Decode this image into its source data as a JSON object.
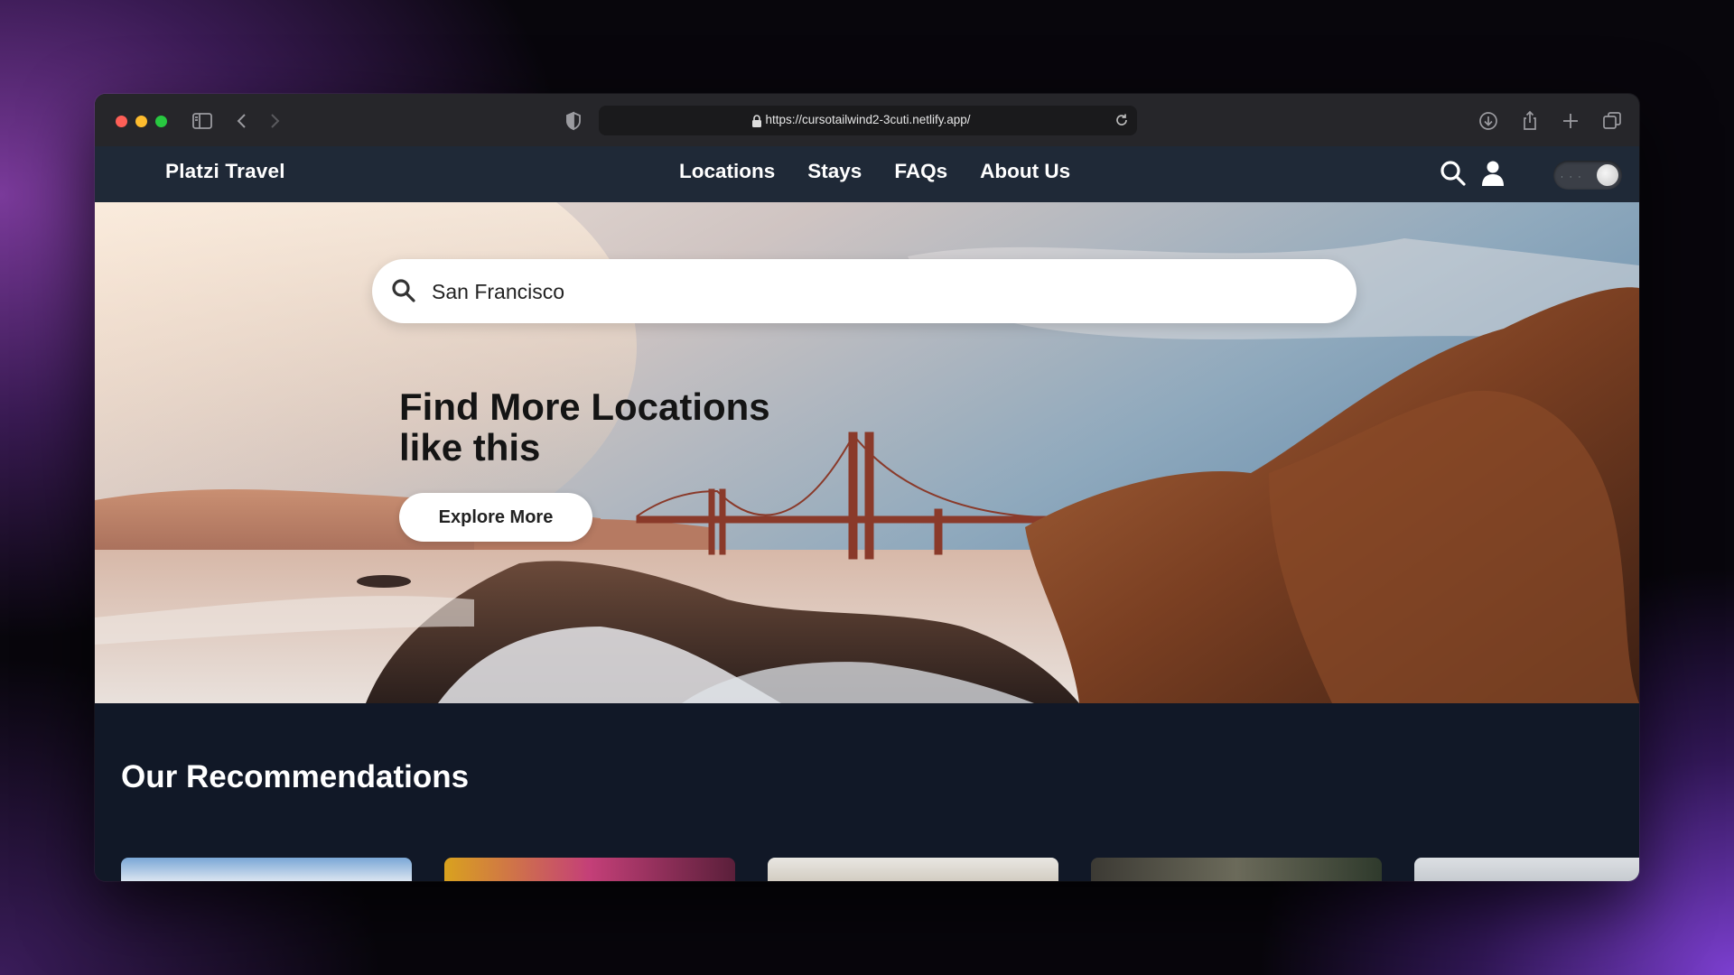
{
  "browser": {
    "url": "https://cursotailwind2-3cuti.netlify.app/"
  },
  "nav": {
    "brand": "Platzi Travel",
    "links": [
      {
        "label": "Locations"
      },
      {
        "label": "Stays"
      },
      {
        "label": "FAQs"
      },
      {
        "label": "About Us"
      }
    ],
    "icons": [
      "search-icon",
      "user-icon"
    ],
    "theme_toggle": "dark-mode-toggle"
  },
  "hero": {
    "search_value": "San Francisco",
    "headline_line1": "Find More Locations",
    "headline_line2": "like this",
    "cta_label": "Explore More"
  },
  "recommendations": {
    "title": "Our Recommendations",
    "cards": [
      {
        "name": "recommendation-card-1",
        "color": "#5b8fc4"
      },
      {
        "name": "recommendation-card-2",
        "color": "#c43f78"
      },
      {
        "name": "recommendation-card-3",
        "color": "#d9d6cf"
      },
      {
        "name": "recommendation-card-4",
        "color": "#4a4a3e"
      },
      {
        "name": "recommendation-card-5",
        "color": "#cfd2d6"
      }
    ]
  },
  "colors": {
    "nav_bg": "#1f2937",
    "page_bg": "#111827"
  }
}
